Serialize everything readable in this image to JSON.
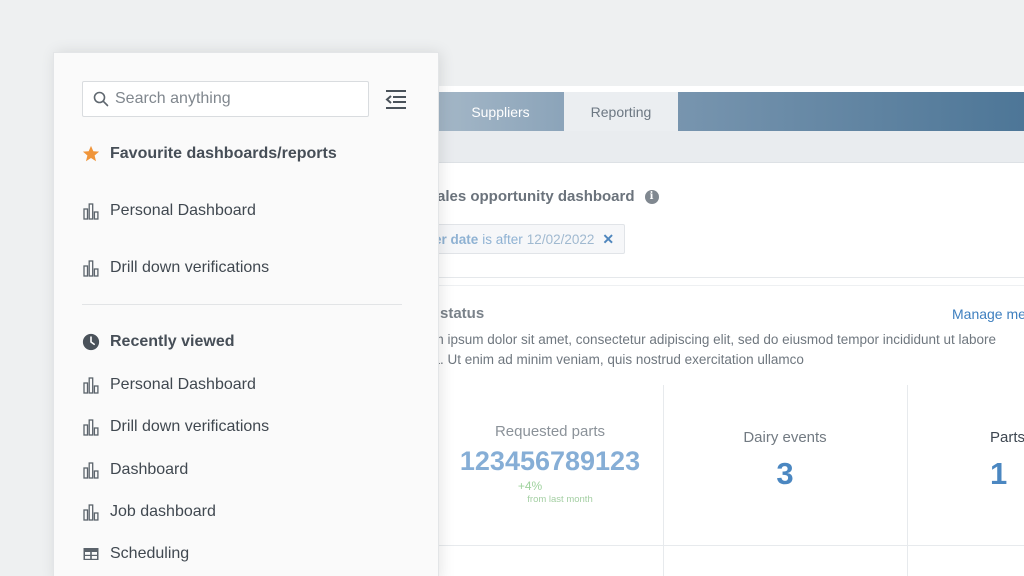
{
  "tabs": {
    "suppliers": "Suppliers",
    "reporting": "Reporting"
  },
  "dashboard": {
    "title": "ales opportunity dashboard",
    "filter": {
      "field": "er date",
      "operator": "is after",
      "value": "12/02/2022",
      "remove_label": "✕"
    }
  },
  "section": {
    "title": "rt status",
    "manage_link": "Manage me",
    "description_line1": "em ipsum dolor sit amet, consectetur adipiscing elit, sed do eiusmod tempor incididunt ut labore",
    "description_line2": "ua. Ut enim ad minim veniam, quis nostrud exercitation ullamco"
  },
  "kpis": [
    {
      "label": "Requested parts",
      "value": "123456789123",
      "delta": "+4%",
      "delta_sub": "from last month"
    },
    {
      "label": "Dairy events",
      "value": "3"
    },
    {
      "label": "Parts",
      "value": "1"
    }
  ],
  "sidebar": {
    "search_placeholder": "Search anything",
    "favourites": {
      "heading": "Favourite dashboards/reports",
      "items": [
        {
          "label": "Personal Dashboard",
          "icon": "bar-chart-icon"
        },
        {
          "label": "Drill down verifications",
          "icon": "bar-chart-icon"
        }
      ]
    },
    "recent": {
      "heading": "Recently viewed",
      "items": [
        {
          "label": "Personal Dashboard",
          "icon": "bar-chart-icon"
        },
        {
          "label": "Drill down verifications",
          "icon": "bar-chart-icon"
        },
        {
          "label": "Dashboard",
          "icon": "bar-chart-icon"
        },
        {
          "label": "Job dashboard",
          "icon": "bar-chart-icon"
        },
        {
          "label": "Scheduling",
          "icon": "table-icon"
        }
      ]
    }
  },
  "colors": {
    "accent": "#4b87c1",
    "star": "#f0953a",
    "tabbar_end": "#4d7697",
    "delta_green": "#9fd29e"
  }
}
